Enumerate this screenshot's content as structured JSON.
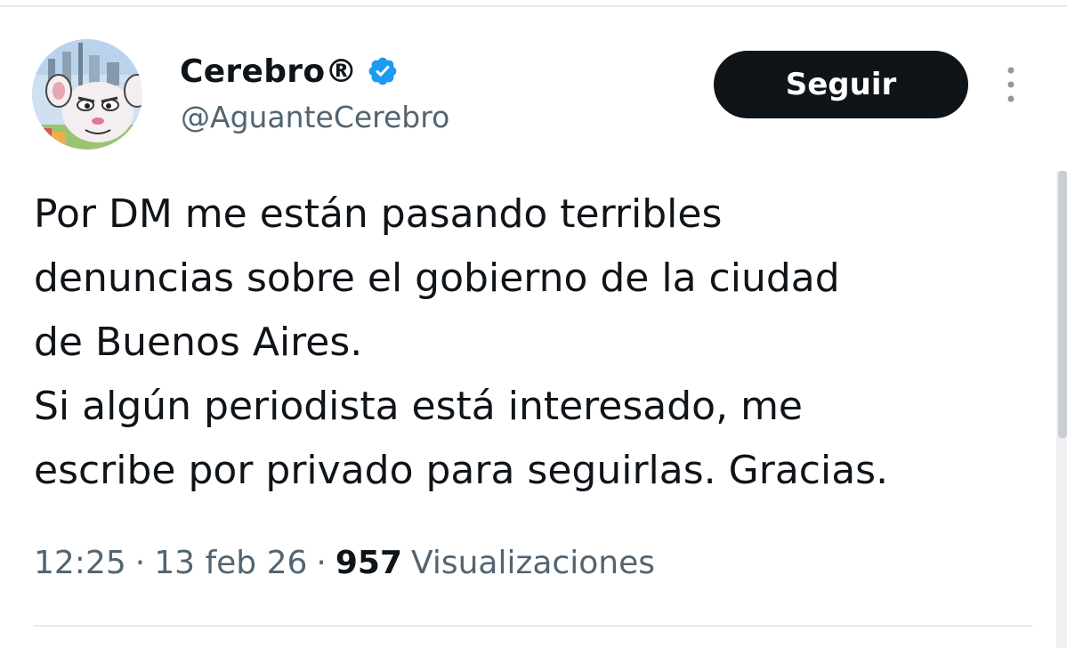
{
  "tweet": {
    "author": {
      "display_name": "Cerebro®",
      "handle": "@AguanteCerebro",
      "verified": true
    },
    "follow_label": "Seguir",
    "text_lines": [
      "Por DM me están pasando terribles",
      "denuncias sobre el gobierno de la ciudad",
      "de Buenos Aires.",
      "Si algún periodista está interesado, me",
      "escribe por privado para seguirlas. Gracias."
    ],
    "meta": {
      "time": "12:25",
      "separator": "·",
      "date": "13 feb 26",
      "views_count": "957",
      "views_label": "Visualizaciones"
    }
  },
  "icons": {
    "verified": "verified-badge-icon",
    "more": "more-vertical-icon"
  },
  "colors": {
    "text_primary": "#0f1419",
    "text_secondary": "#536471",
    "verified_blue": "#1d9bf0",
    "button_bg": "#0f1419",
    "button_text": "#ffffff",
    "divider": "#e6e8ea"
  }
}
